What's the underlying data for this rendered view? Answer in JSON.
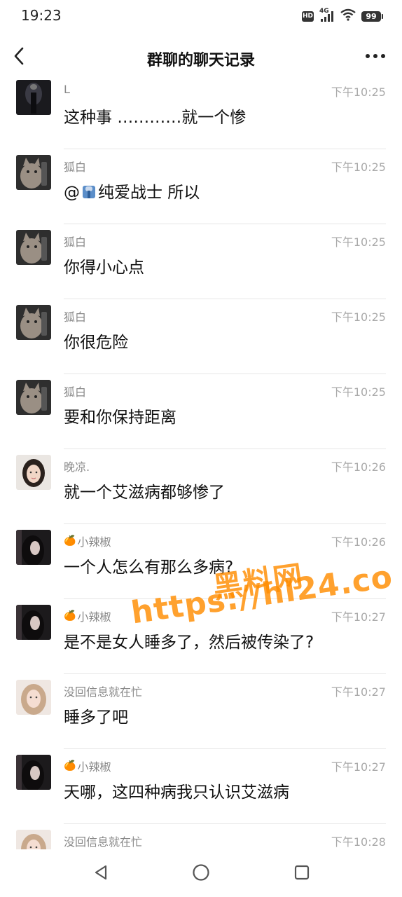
{
  "status_bar": {
    "time": "19:23",
    "hd": "HD",
    "network": "4G",
    "battery": "99"
  },
  "header": {
    "title": "群聊的聊天记录",
    "back_icon": "chevron-left-icon",
    "more_icon": "more-horizontal-icon"
  },
  "messages": [
    {
      "sender": "L",
      "time": "下午10:25",
      "text": "这种事 …………就一个惨",
      "avatar": "avatar-dark"
    },
    {
      "sender": "狐白",
      "time": "下午10:25",
      "text_prefix": "@",
      "mention_emoji": "hoodie-emoji",
      "text_suffix": "纯爱战士 所以",
      "avatar": "avatar-cat"
    },
    {
      "sender": "狐白",
      "time": "下午10:25",
      "text": "你得小心点",
      "avatar": "avatar-cat"
    },
    {
      "sender": "狐白",
      "time": "下午10:25",
      "text": "你很危险",
      "avatar": "avatar-cat"
    },
    {
      "sender": "狐白",
      "time": "下午10:25",
      "text": "要和你保持距离",
      "avatar": "avatar-cat"
    },
    {
      "sender": "晚凉.",
      "time": "下午10:26",
      "text": "就一个艾滋病都够惨了",
      "avatar": "avatar-girl"
    },
    {
      "sender_emoji": "🍊",
      "sender": "小辣椒",
      "time": "下午10:26",
      "text": "一个人怎么有那么多病?",
      "avatar": "avatar-dark-girl"
    },
    {
      "sender_emoji": "🍊",
      "sender": "小辣椒",
      "time": "下午10:27",
      "text": "是不是女人睡多了，然后被传染了?",
      "avatar": "avatar-dark-girl"
    },
    {
      "sender": "没回信息就在忙",
      "time": "下午10:27",
      "text": "睡多了吧",
      "avatar": "avatar-blonde"
    },
    {
      "sender_emoji": "🍊",
      "sender": "小辣椒",
      "time": "下午10:27",
      "text": "天哪，这四种病我只认识艾滋病",
      "avatar": "avatar-dark-girl"
    },
    {
      "sender": "没回信息就在忙",
      "time": "下午10:28",
      "text": "",
      "avatar": "avatar-blonde"
    }
  ],
  "watermark": {
    "line1": "黑料网",
    "line2": "https://hl24.co"
  },
  "nav_bar": {
    "back_icon": "triangle-back-icon",
    "home_icon": "circle-home-icon",
    "recents_icon": "square-recents-icon"
  },
  "colors": {
    "watermark": "#ff8c00",
    "secondary_text": "#888888",
    "time_text": "#aaaaaa",
    "divider": "#e6e6e6"
  }
}
